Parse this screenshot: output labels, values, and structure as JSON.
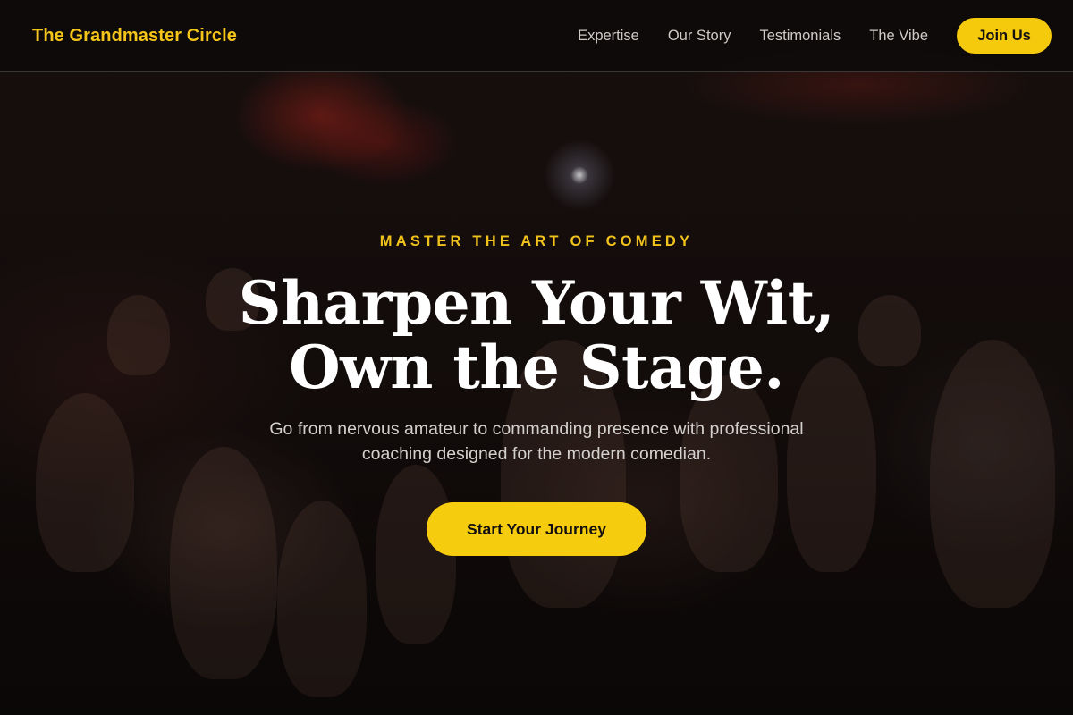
{
  "nav": {
    "brand": "The Grandmaster Circle",
    "links": [
      "Expertise",
      "Our Story",
      "Testimonials",
      "The Vibe"
    ],
    "join_label": "Join Us"
  },
  "hero": {
    "eyebrow": "MASTER THE ART OF COMEDY",
    "headline_line1": "Sharpen Your Wit,",
    "headline_line2": "Own the Stage.",
    "subtitle": "Go from nervous amateur to commanding presence with professional coaching designed for the modern comedian.",
    "cta_label": "Start Your Journey"
  },
  "colors": {
    "accent": "#f5c90c",
    "nav_background": "#0e0b0b",
    "headline": "#ffffff"
  }
}
